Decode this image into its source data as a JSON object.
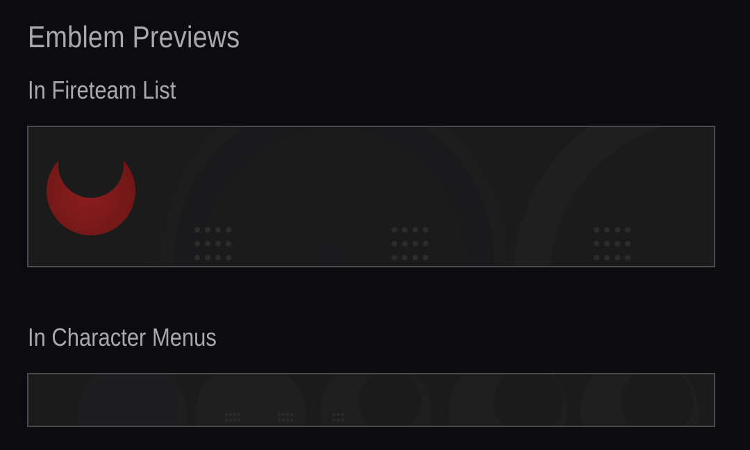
{
  "page": {
    "title": "Emblem Previews"
  },
  "sections": [
    {
      "heading": "In Fireteam List",
      "preview": "fireteam-emblem-banner"
    },
    {
      "heading": "In Character Menus",
      "preview": "character-emblem-banner"
    }
  ],
  "colors": {
    "background": "#0b0b10",
    "text": "#a8a8ae",
    "banner_border": "#4a4a4c",
    "banner_fill": "#1b1b1c",
    "emblem_red": "#8e1d1d"
  },
  "icons": {
    "emblem": "crescent-moon-icon"
  }
}
